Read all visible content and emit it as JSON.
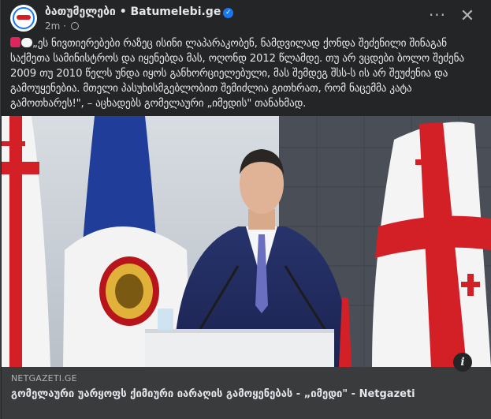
{
  "post": {
    "page_name": "ბათუმელები • Batumelebi.ge",
    "time": "2m",
    "meta_sep": "·",
    "more_label": "···",
    "close_label": "✕",
    "verified_glyph": "✓",
    "text": "„ეს ნივთიერებები რაზეც ისინი ლაპარაკობენ, ნამდვილად ქონდა შეძენილი შინაგან საქმეთა სამინისტროს და იყენებდა მას, ოღონდ 2012 წლამდე. თუ არ ვცდები ბოლო შეძენა 2009 თუ 2010 წელს უნდა იყოს განხორციელებული, მას შემდეგ შსს-ს ის არ შეუძენია და გამოუყენებია. მთელი პასუხისმგებლობით შემიძლია გითხრათ, რომ ნაცემმა კატა გამოთხარეს!\", – აცხადებს გომელაური „იმედის\" თანახმად.",
    "emojis": [
      "red-square-emoji",
      "speech-bubble-emoji"
    ]
  },
  "link": {
    "domain": "NETGAZETI.GE",
    "title": "გომელაური უარყოფს ქიმიური იარაღის გამოყენებას - „იმედი\" - Netgazeti",
    "info_label": "i"
  },
  "colors": {
    "background": "#242526",
    "link_bar": "#3a3b3c",
    "accent": "#1877f2",
    "georgian_red": "#d32027",
    "police_blue": "#1f3d99"
  }
}
